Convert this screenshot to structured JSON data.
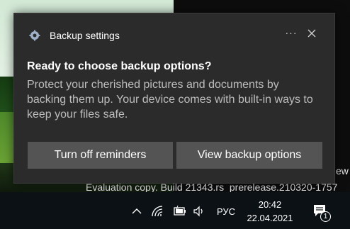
{
  "toast": {
    "app_name": "Backup settings",
    "more_label": "···",
    "title": "Ready to choose backup options?",
    "body": "Protect your cherished pictures and documents by backing them up. Your device comes with built-in ways to keep your files safe.",
    "buttons": [
      {
        "label": "Turn off reminders"
      },
      {
        "label": "View backup options"
      }
    ],
    "icons": {
      "app": "gear-icon",
      "close": "close-icon"
    }
  },
  "desktop": {
    "watermark": "Evaluation copy. Build 21343.rs_prerelease.210320-1757",
    "watermark_partial": "ew"
  },
  "taskbar": {
    "tray_icons": [
      "chevron-up-icon",
      "wifi-icon",
      "battery-icon",
      "speaker-icon"
    ],
    "language": "РУС",
    "time": "20:42",
    "date": "22.04.2021",
    "notification_count": "1"
  },
  "colors": {
    "toast_bg": "#2b2b2b",
    "button_bg": "#545454",
    "body_text": "#bdbdbd",
    "taskbar_bg": "#0c1116"
  }
}
